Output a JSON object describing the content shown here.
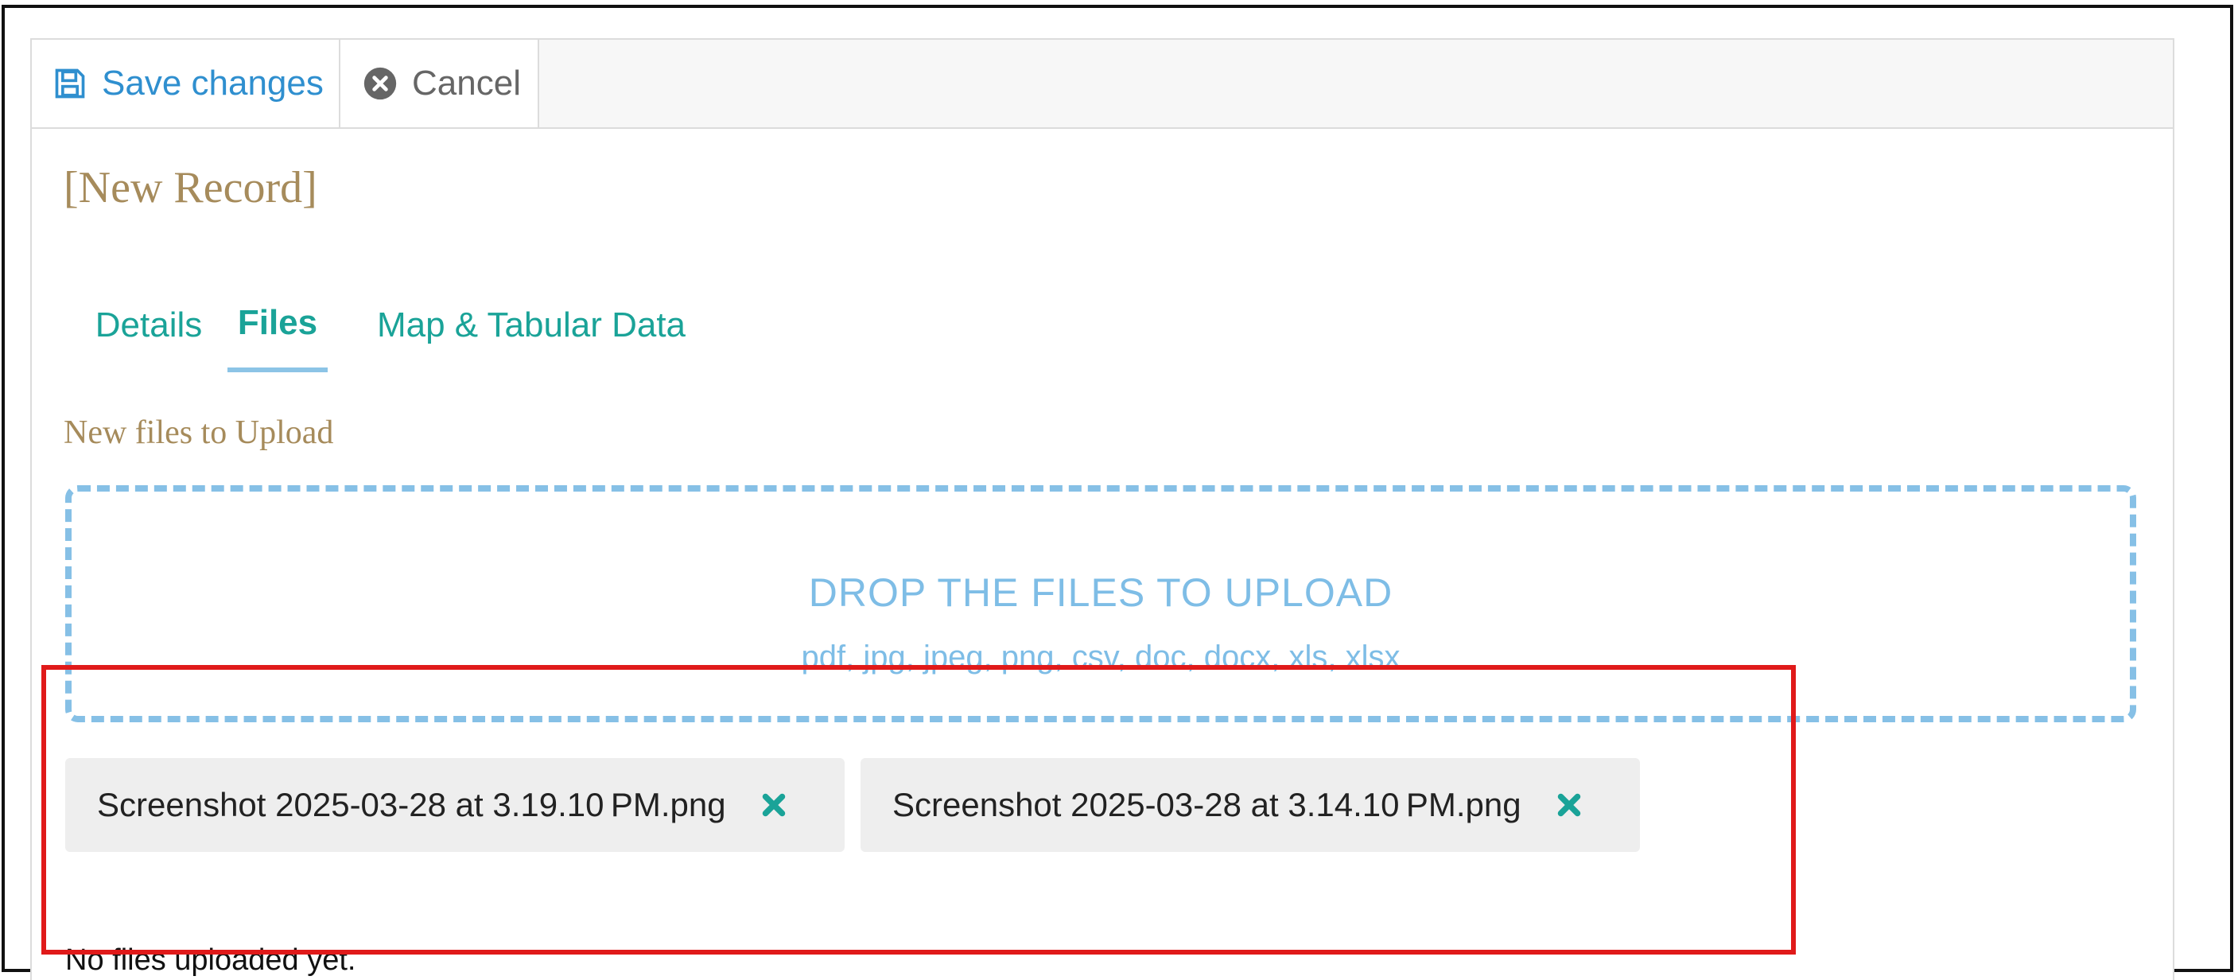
{
  "toolbar": {
    "save_label": "Save changes",
    "cancel_label": "Cancel",
    "save_icon": "floppy-disk-icon",
    "cancel_icon": "close-circle-icon"
  },
  "record": {
    "title": "[New Record]"
  },
  "tabs": [
    {
      "label": "Details",
      "active": false
    },
    {
      "label": "Files",
      "active": true
    },
    {
      "label": "Map & Tabular Data",
      "active": false
    }
  ],
  "upload": {
    "section_label": "New files to Upload",
    "dropzone_title": "DROP THE FILES TO UPLOAD",
    "allowed_types": "pdf, jpg, jpeg, png, csv, doc, docx, xls, xlsx",
    "pending_files": [
      {
        "name": "Screenshot 2025-03-28 at 3.19.10 PM.png"
      },
      {
        "name": "Screenshot 2025-03-28 at 3.14.10 PM.png"
      }
    ],
    "empty_message": "No files uploaded yet."
  },
  "colors": {
    "accent_blue": "#2f8fcf",
    "tab_teal": "#1aa398",
    "title_tan": "#a68b5b",
    "dropzone_blue": "#86c0e6",
    "highlight_red": "#e01a1a"
  }
}
